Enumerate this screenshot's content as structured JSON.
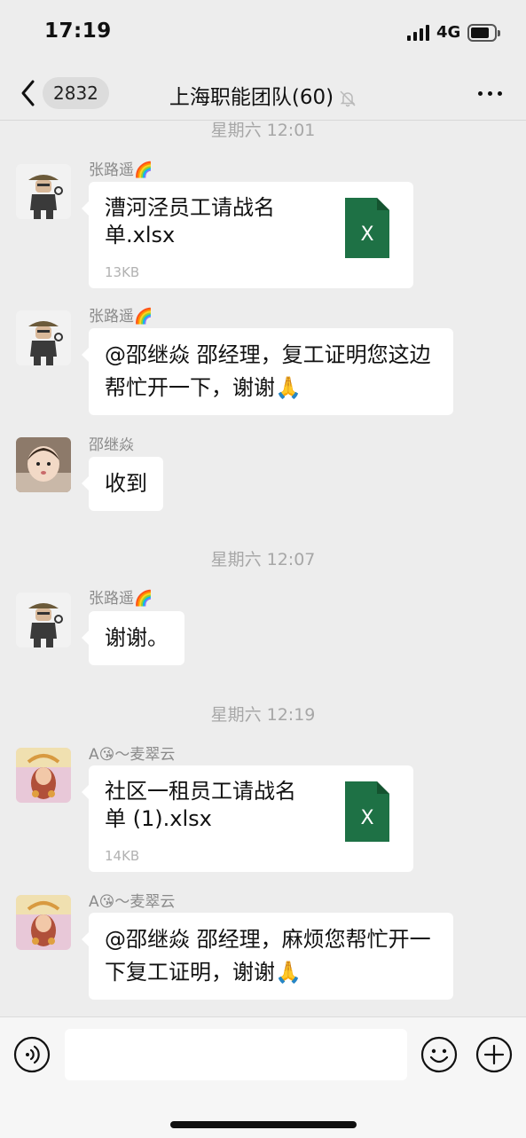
{
  "status_bar": {
    "time": "17:19",
    "network": "4G",
    "battery_level": 0.8
  },
  "nav": {
    "unread_count": "2832",
    "title": "上海职能团队(60)",
    "muted": true
  },
  "messages": [
    {
      "type": "timestamp",
      "text": "星期六 12:01"
    },
    {
      "type": "file",
      "sender": "张路遥🌈",
      "file_name": "漕河泾员工请战名单.xlsx",
      "file_size": "13KB",
      "file_icon": "excel-icon"
    },
    {
      "type": "text",
      "sender": "张路遥🌈",
      "text": "@邵继焱 邵经理，复工证明您这边帮忙开一下，谢谢🙏"
    },
    {
      "type": "text",
      "sender": "邵继焱",
      "text": "收到"
    },
    {
      "type": "timestamp",
      "text": "星期六 12:07"
    },
    {
      "type": "text",
      "sender": "张路遥🌈",
      "text": "谢谢。"
    },
    {
      "type": "timestamp",
      "text": "星期六 12:19"
    },
    {
      "type": "file",
      "sender": "A😘～麦翠云",
      "file_name": "社区一租员工请战名单 (1).xlsx",
      "file_size": "14KB",
      "file_icon": "excel-icon"
    },
    {
      "type": "text",
      "sender": "A😘～麦翠云",
      "text": "@邵继焱 邵经理，麻烦您帮忙开一下复工证明，谢谢🙏"
    }
  ],
  "input_bar": {
    "placeholder": ""
  },
  "colors": {
    "background": "#ededed",
    "bubble": "#ffffff",
    "excel_green": "#1e7145",
    "timestamp": "#a7a7a7"
  }
}
